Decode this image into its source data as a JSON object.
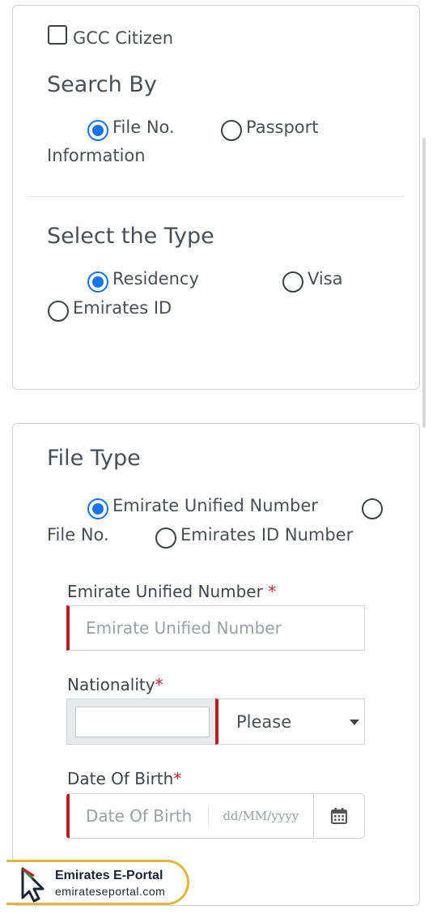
{
  "gcc": {
    "label": "GCC Citizen"
  },
  "search_by": {
    "heading": "Search By",
    "options": [
      {
        "label": "File No.",
        "checked": true
      },
      {
        "label": "Passport",
        "checked": false
      }
    ],
    "wrap_text": "Information"
  },
  "select_type": {
    "heading": "Select the Type",
    "options": [
      {
        "label": "Residency",
        "checked": true
      },
      {
        "label": "Visa",
        "checked": false
      },
      {
        "label": "Emirates ID",
        "checked": false
      }
    ]
  },
  "file_type": {
    "heading": "File Type",
    "options": [
      {
        "label": "Emirate Unified Number",
        "checked": true
      },
      {
        "label": "File No.",
        "checked": false
      },
      {
        "label": "Emirates ID Number",
        "checked": false
      }
    ]
  },
  "form": {
    "unified_number": {
      "label": "Emirate Unified Number",
      "required": "*",
      "placeholder": "Emirate Unified Number"
    },
    "nationality": {
      "label": "Nationality",
      "required": "*",
      "select_value": "Please"
    },
    "dob": {
      "label": "Date Of Birth",
      "required": "*",
      "placeholder": "Date Of Birth",
      "format_hint": "dd/MM/yyyy"
    }
  },
  "watermark": {
    "title": "Emirates E-Portal",
    "url": "emirateseportal.com"
  },
  "colors": {
    "accent_blue": "#1a73e8",
    "required_red": "#c0262d",
    "border": "#cfd4da",
    "logo_gold": "#e0b73a"
  }
}
